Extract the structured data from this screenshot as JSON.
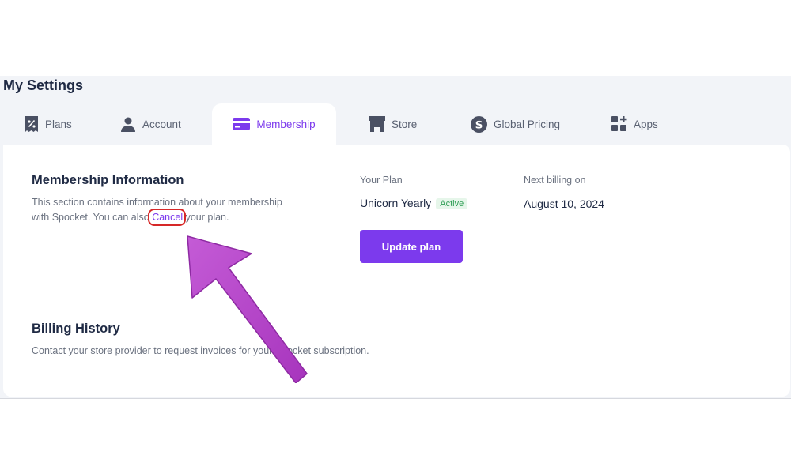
{
  "page": {
    "title": "My Settings"
  },
  "tabs": [
    {
      "label": "Plans",
      "icon": "receipt-percent-icon"
    },
    {
      "label": "Account",
      "icon": "user-icon"
    },
    {
      "label": "Membership",
      "icon": "credit-card-icon",
      "active": true
    },
    {
      "label": "Store",
      "icon": "storefront-icon"
    },
    {
      "label": "Global Pricing",
      "icon": "dollar-circle-icon"
    },
    {
      "label": "Apps",
      "icon": "apps-plus-icon"
    }
  ],
  "membership": {
    "title": "Membership Information",
    "desc_line1": "This section contains information about your membership",
    "desc_line2_before": "with Spocket. You can also ",
    "cancel_label": "Cancel",
    "desc_line2_after": " your plan.",
    "plan_label": "Your Plan",
    "plan_name": "Unicorn Yearly",
    "plan_status": "Active",
    "update_button": "Update plan",
    "next_billing_label": "Next billing on",
    "next_billing_date": "August 10, 2024"
  },
  "billing": {
    "title": "Billing History",
    "desc": "Contact your store provider to request invoices for your Spocket subscription."
  },
  "colors": {
    "accent": "#7c3aed",
    "annotation_arrow": "#b449c9",
    "highlight_ring": "#d62828",
    "active_badge_text": "#2f9e55"
  }
}
